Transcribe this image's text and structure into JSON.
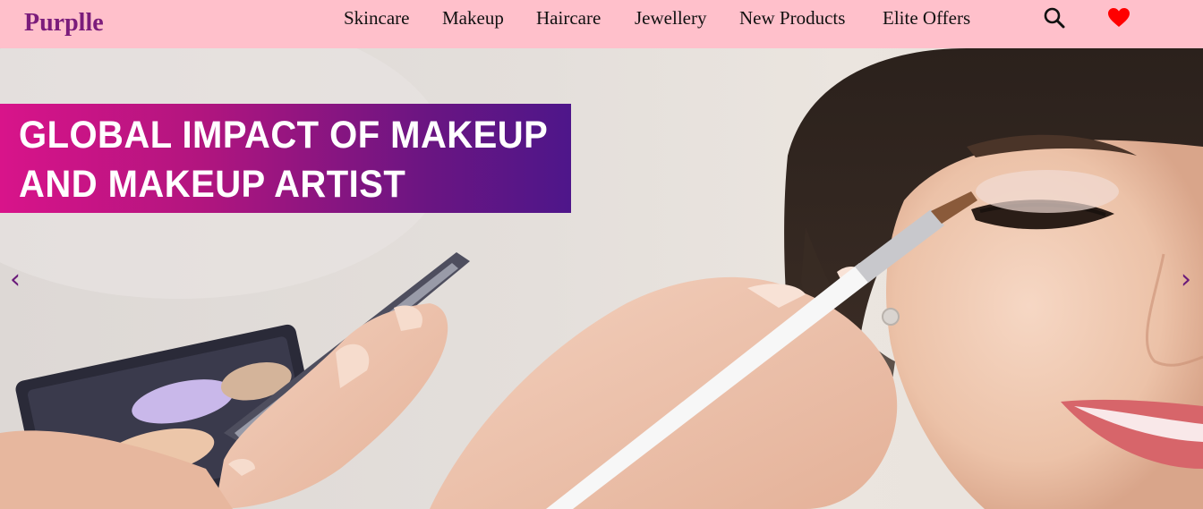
{
  "navbar": {
    "brand": "Purplle",
    "links": [
      {
        "label": "Skincare"
      },
      {
        "label": "Makeup"
      },
      {
        "label": "Haircare"
      },
      {
        "label": "Jewellery"
      },
      {
        "label": "New Products"
      },
      {
        "label": "Elite Offers"
      }
    ],
    "search_icon": "search-icon",
    "wishlist_icon": "heart-icon"
  },
  "hero": {
    "banner": {
      "line1": "GLOBAL IMPACT OF MAKEUP",
      "line2": "AND MAKEUP ARTIST"
    },
    "prev_label": "‹",
    "next_label": "›"
  },
  "colors": {
    "navbar_bg": "#ffc0cb",
    "brand": "#7b1c7b",
    "banner_start": "#d8148a",
    "banner_end": "#4e168a",
    "heart": "#ff0000",
    "carousel_control": "#6a1a7a"
  }
}
